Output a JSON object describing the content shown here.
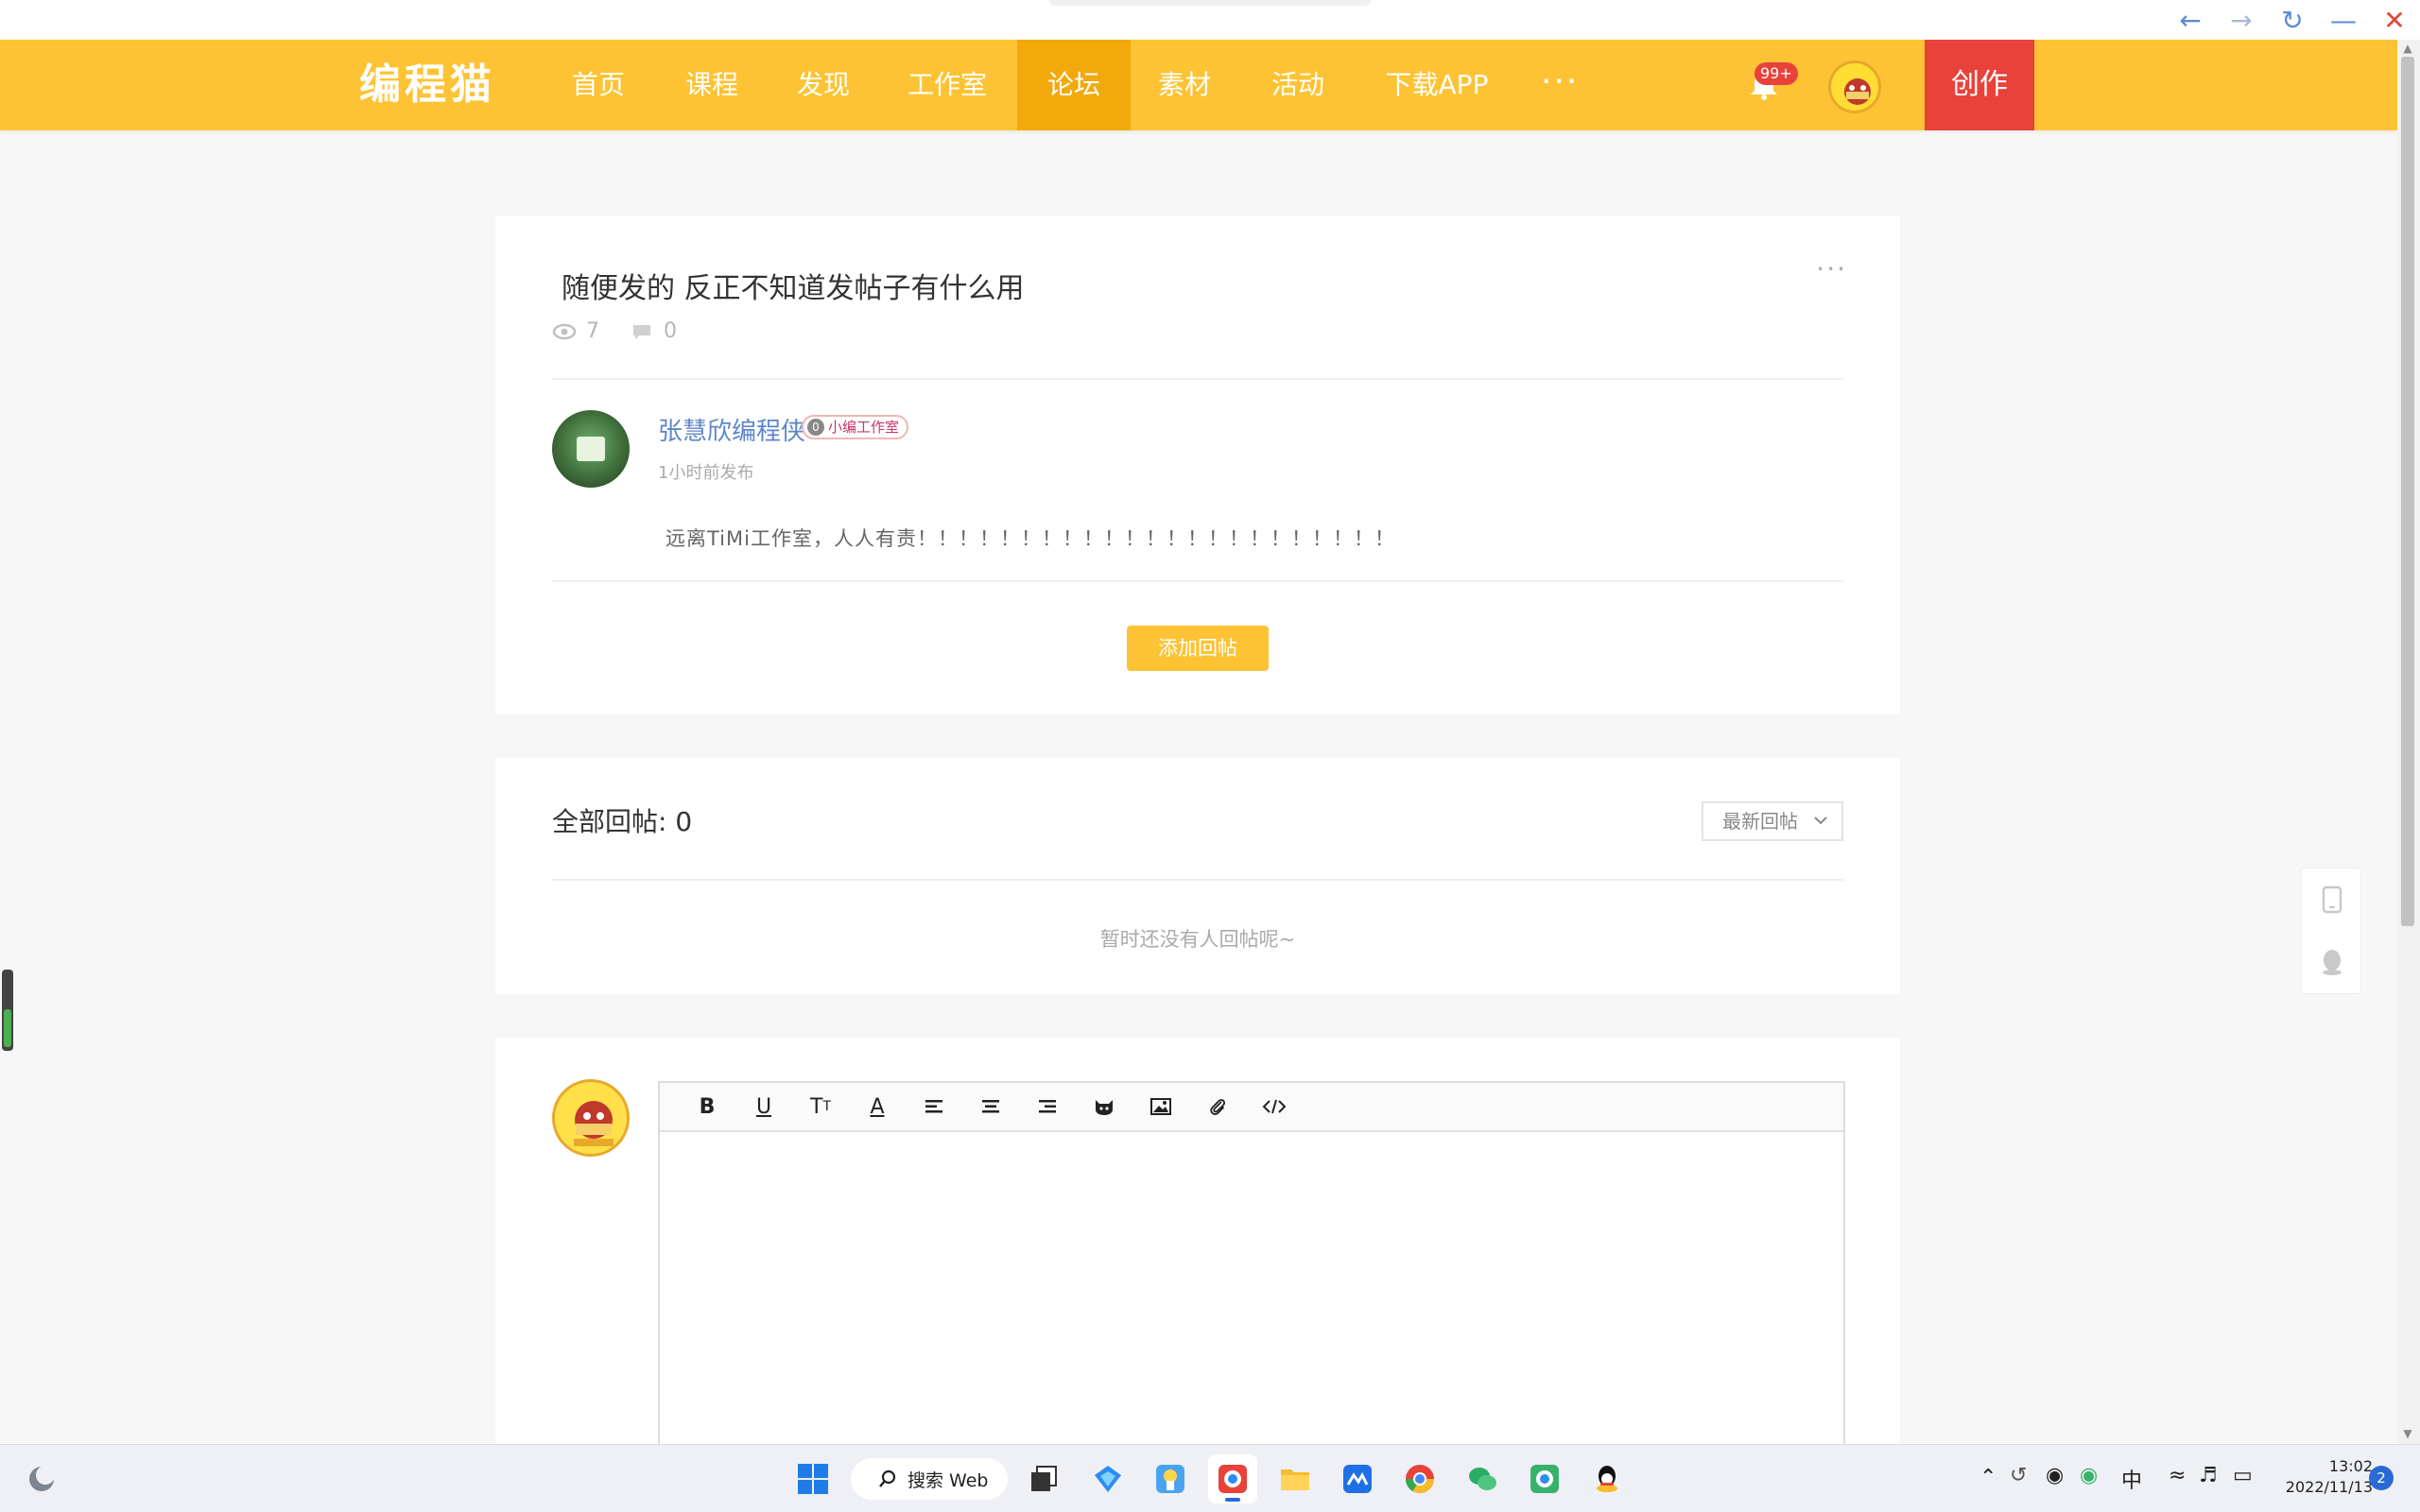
{
  "nav": {
    "logo": "编程猫",
    "items": [
      "首页",
      "课程",
      "发现",
      "工作室",
      "论坛",
      "素材",
      "活动",
      "下载APP"
    ],
    "more": "···",
    "notification_badge": "99+",
    "create_label": "创作",
    "active_item": "论坛"
  },
  "post": {
    "title": "随便发的 反正不知道发帖子有什么用",
    "more": "···",
    "views": "7",
    "comments": "0",
    "author": "张慧欣编程侠",
    "badge_level": "0",
    "badge_label": "小编工作室",
    "time": "1小时前发布",
    "content": "远离TiMi工作室，人人有责！！！！！！！！！！！！！！！！！！！！！！！",
    "reply_button": "添加回帖"
  },
  "replies": {
    "title": "全部回帖: 0",
    "sort_label": "最新回帖",
    "empty_text": "暂时还没有人回帖呢~"
  },
  "editor": {
    "toolbar": [
      "bold-icon",
      "underline-icon",
      "text-size-icon",
      "font-color-icon",
      "align-left-icon",
      "align-center-icon",
      "align-right-icon",
      "emoji-icon",
      "image-icon",
      "attachment-icon",
      "code-icon"
    ]
  },
  "taskbar": {
    "search_label": "搜索 Web",
    "ime": "中",
    "time": "13:02",
    "date": "2022/11/13",
    "notification_count": "2"
  },
  "colors": {
    "nav_bg": "#fdc334",
    "nav_active": "#f2a90b",
    "create_bg": "#e8423a",
    "link": "#5c86c8"
  }
}
